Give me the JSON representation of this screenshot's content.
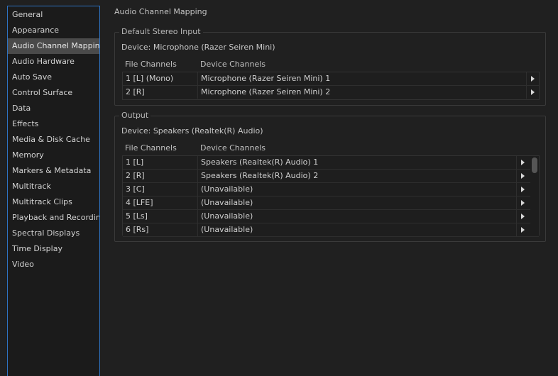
{
  "sidebar": {
    "items": [
      {
        "label": "General"
      },
      {
        "label": "Appearance"
      },
      {
        "label": "Audio Channel Mapping",
        "selected": true
      },
      {
        "label": "Audio Hardware"
      },
      {
        "label": "Auto Save"
      },
      {
        "label": "Control Surface"
      },
      {
        "label": "Data"
      },
      {
        "label": "Effects"
      },
      {
        "label": "Media & Disk Cache"
      },
      {
        "label": "Memory"
      },
      {
        "label": "Markers & Metadata"
      },
      {
        "label": "Multitrack"
      },
      {
        "label": "Multitrack Clips"
      },
      {
        "label": "Playback and Recording"
      },
      {
        "label": "Spectral Displays"
      },
      {
        "label": "Time Display"
      },
      {
        "label": "Video"
      }
    ]
  },
  "main": {
    "title": "Audio Channel Mapping",
    "input": {
      "group_title": "Default Stereo Input",
      "device": "Device: Microphone (Razer Seiren Mini)",
      "col_file": "File Channels",
      "col_device": "Device Channels",
      "rows": [
        {
          "file": "1 [L] (Mono)",
          "device": "Microphone (Razer Seiren Mini) 1"
        },
        {
          "file": "2 [R]",
          "device": "Microphone (Razer Seiren Mini) 2"
        }
      ]
    },
    "output": {
      "group_title": "Output",
      "device": "Device: Speakers (Realtek(R) Audio)",
      "col_file": "File Channels",
      "col_device": "Device Channels",
      "rows": [
        {
          "file": "1 [L]",
          "device": "Speakers (Realtek(R) Audio) 1"
        },
        {
          "file": "2 [R]",
          "device": "Speakers (Realtek(R) Audio) 2"
        },
        {
          "file": "3 [C]",
          "device": "(Unavailable)"
        },
        {
          "file": "4 [LFE]",
          "device": "(Unavailable)"
        },
        {
          "file": "5 [Ls]",
          "device": "(Unavailable)"
        },
        {
          "file": "6 [Rs]",
          "device": "(Unavailable)"
        }
      ]
    }
  },
  "icons": {
    "row_arrow": "play-triangle-right-icon"
  },
  "colors": {
    "accent_border": "#2e73c3",
    "selected_bg": "#4a4a4a",
    "background": "#202020"
  }
}
